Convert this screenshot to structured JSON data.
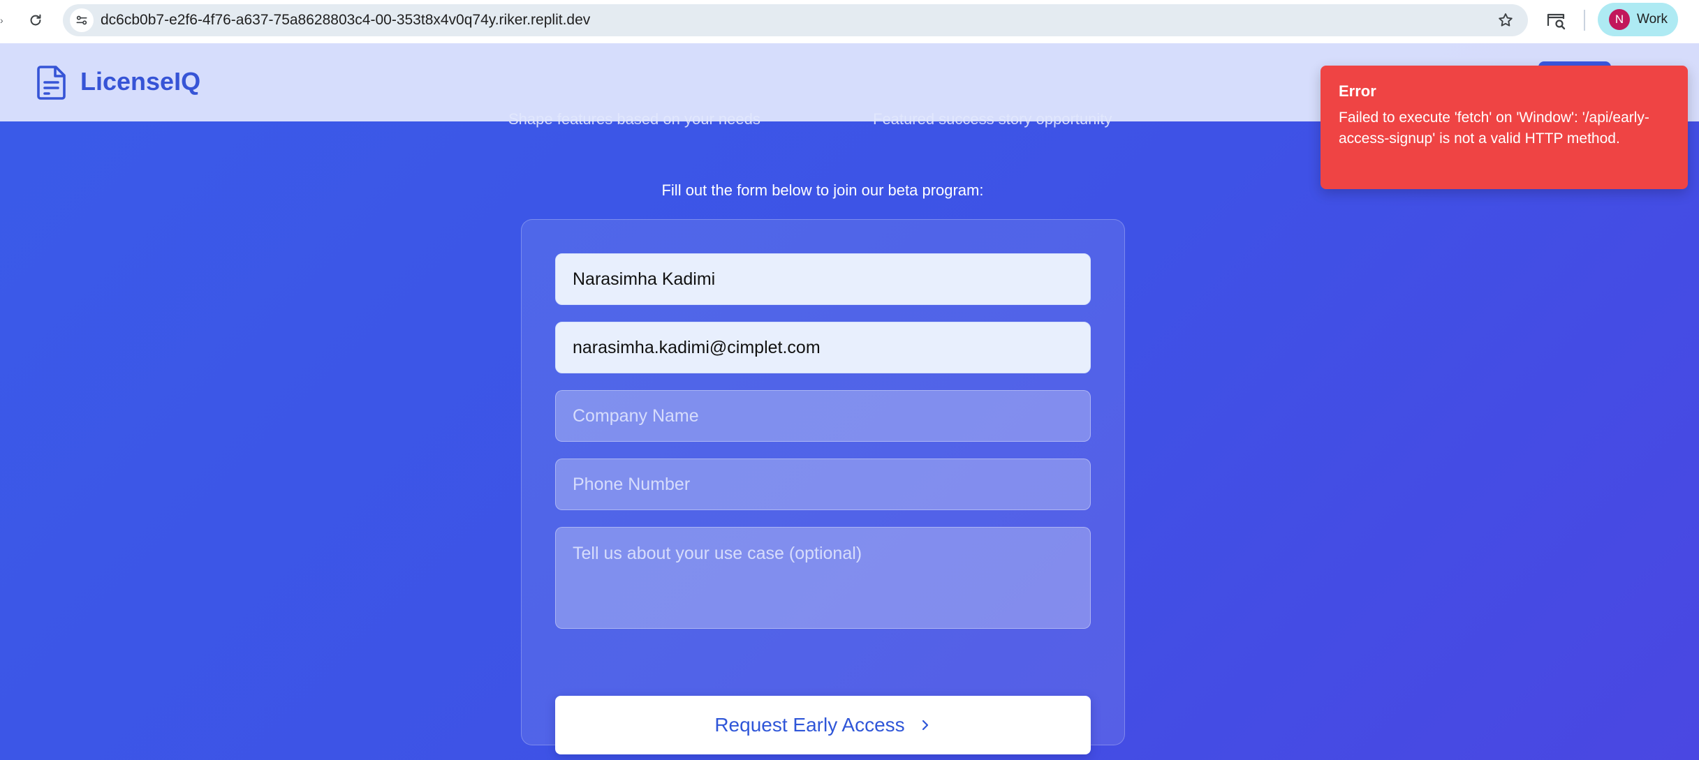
{
  "browser": {
    "url": "dc6cb0b7-e2f6-4f76-a637-75a8628803c4-00-353t8x4v0q74y.riker.replit.dev",
    "profile": {
      "initial": "N",
      "label": "Work",
      "color": "#c2185b"
    }
  },
  "header": {
    "brand": "LicenseIQ",
    "brand_color": "#3654d6"
  },
  "background_text": {
    "left": "Shape features based on your needs",
    "right": "Featured success story opportunity"
  },
  "form": {
    "intro": "Fill out the form below to join our beta program:",
    "name_value": "Narasimha Kadimi",
    "email_value": "narasimha.kadimi@cimplet.com",
    "company_placeholder": "Company Name",
    "phone_placeholder": "Phone Number",
    "usecase_placeholder": "Tell us about your use case (optional)",
    "submit_label": "Request Early Access"
  },
  "toast": {
    "title": "Error",
    "message": "Failed to execute 'fetch' on 'Window': '/api/early-access-signup' is not a valid HTTP method.",
    "color": "#ef4444"
  },
  "icons": [
    "reload-icon",
    "site-info-icon",
    "bookmark-star-icon",
    "tab-search-icon",
    "document-icon",
    "chevron-right-icon"
  ]
}
